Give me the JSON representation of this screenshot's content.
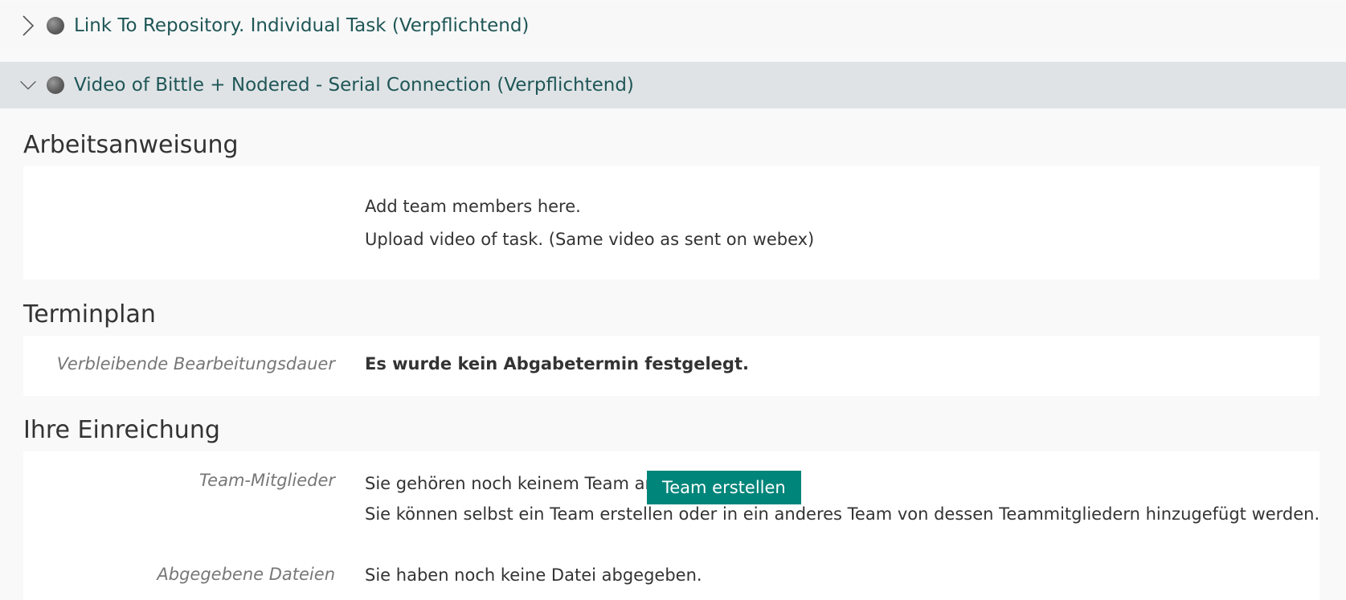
{
  "accordion": {
    "items": [
      {
        "title": "Link To Repository. Individual Task (Verpflichtend)",
        "expanded": false
      },
      {
        "title": "Video of Bittle + Nodered - Serial Connection (Verpflichtend)",
        "expanded": true
      }
    ]
  },
  "sections": {
    "instructions": {
      "heading": "Arbeitsanweisung",
      "lines": [
        "Add team members here.",
        "Upload video of task. (Same video as sent on webex)"
      ]
    },
    "schedule": {
      "heading": "Terminplan",
      "label": "Verbleibende Bearbeitungsdauer",
      "value": "Es wurde kein Abgabetermin festgelegt."
    },
    "submission": {
      "heading": "Ihre Einreichung",
      "team_label": "Team-Mitglieder",
      "team_status": "Sie gehören noch keinem Team an.",
      "create_team_button": "Team erstellen",
      "team_hint": "Sie können selbst ein Team erstellen oder in ein anderes Team von dessen Teammitgliedern hinzugefügt werden.",
      "files_label": "Abgegebene Dateien",
      "files_value": "Sie haben noch keine Datei abgegeben."
    }
  },
  "colors": {
    "accent": "#00857a",
    "link": "#1f5656",
    "expanded_row_bg": "#dfe3e6"
  }
}
